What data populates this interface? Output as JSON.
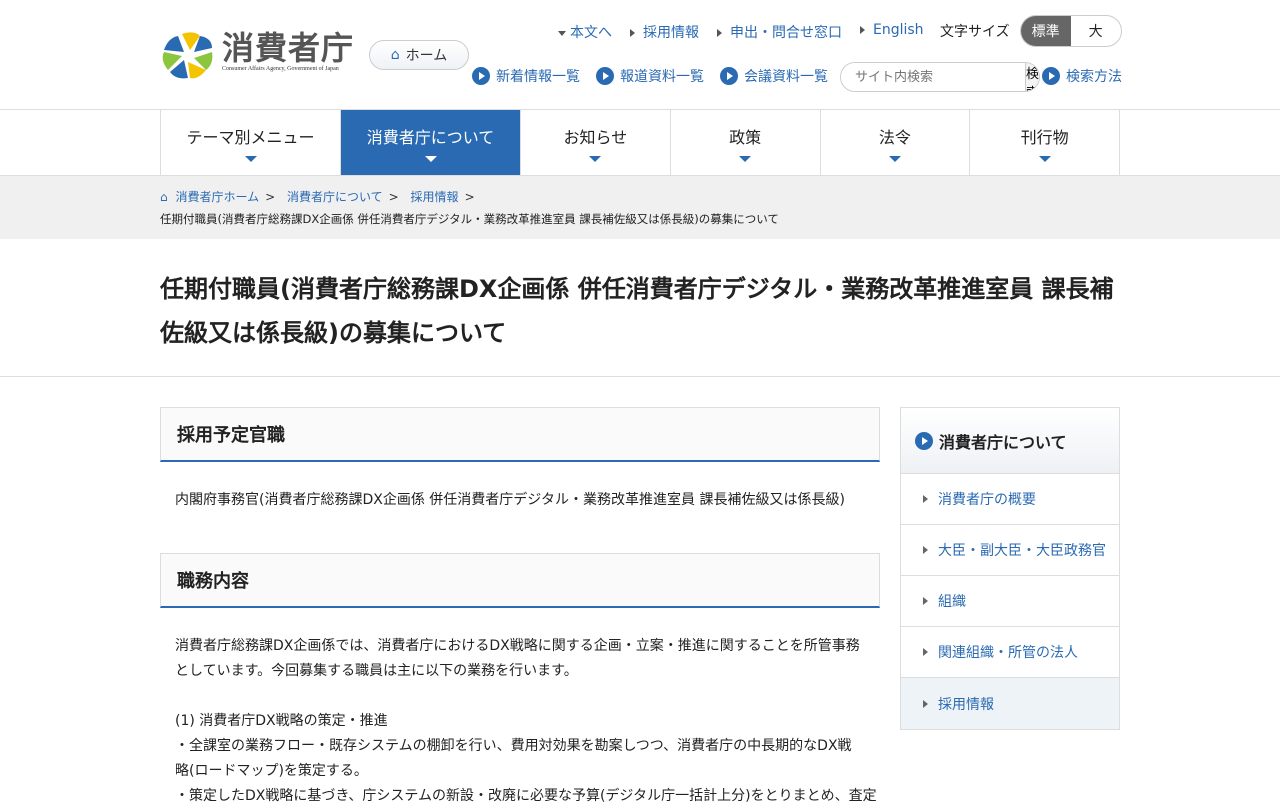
{
  "header": {
    "logo_jp": "消費者庁",
    "logo_en": "Consumer Affairs Agency, Government of Japan",
    "home": "ホーム",
    "top_links": [
      "本文へ",
      "採用情報",
      "申出・問合せ窓口",
      "English"
    ],
    "font_size_label": "文字サイズ",
    "font_std": "標準",
    "font_large": "大",
    "sub_links": [
      "新着情報一覧",
      "報道資料一覧",
      "会議資料一覧"
    ],
    "search_placeholder": "サイト内検索",
    "search_button": "検索",
    "search_howto": "検索方法"
  },
  "nav": [
    "テーマ別メニュー",
    "消費者庁について",
    "お知らせ",
    "政策",
    "法令",
    "刊行物"
  ],
  "breadcrumb": {
    "items": [
      "消費者庁ホーム",
      "消費者庁について",
      "採用情報"
    ],
    "sep": ">",
    "current": "任期付職員(消費者庁総務課DX企画係 併任消費者庁デジタル・業務改革推進室員 課長補佐級又は係長級)の募集について"
  },
  "title": "任期付職員(消費者庁総務課DX企画係 併任消費者庁デジタル・業務改革推進室員 課長補佐級又は係長級)の募集について",
  "sections": [
    {
      "heading": "採用予定官職",
      "body": "内閣府事務官(消費者庁総務課DX企画係 併任消費者庁デジタル・業務改革推進室員 課長補佐級又は係長級)"
    },
    {
      "heading": "職務内容",
      "intro": "消費者庁総務課DX企画係では、消費者庁におけるDX戦略に関する企画・立案・推進に関することを所管事務としています。今回募集する職員は主に以下の業務を行います。",
      "item1": "(1) 消費者庁DX戦略の策定・推進",
      "bullet1": "・全課室の業務フロー・既存システムの棚卸を行い、費用対効果を勘案しつつ、消費者庁の中長期的なDX戦略(ロードマップ)を策定する。",
      "bullet2": "・策定したDX戦略に基づき、庁システムの新設・改廃に必要な予算(デジタル庁一括計上分)をとりまとめ、査定"
    }
  ],
  "sidebar": {
    "heading": "消費者庁について",
    "items": [
      "消費者庁の概要",
      "大臣・副大臣・大臣政務官",
      "組織",
      "関連組織・所管の法人",
      "採用情報"
    ]
  }
}
